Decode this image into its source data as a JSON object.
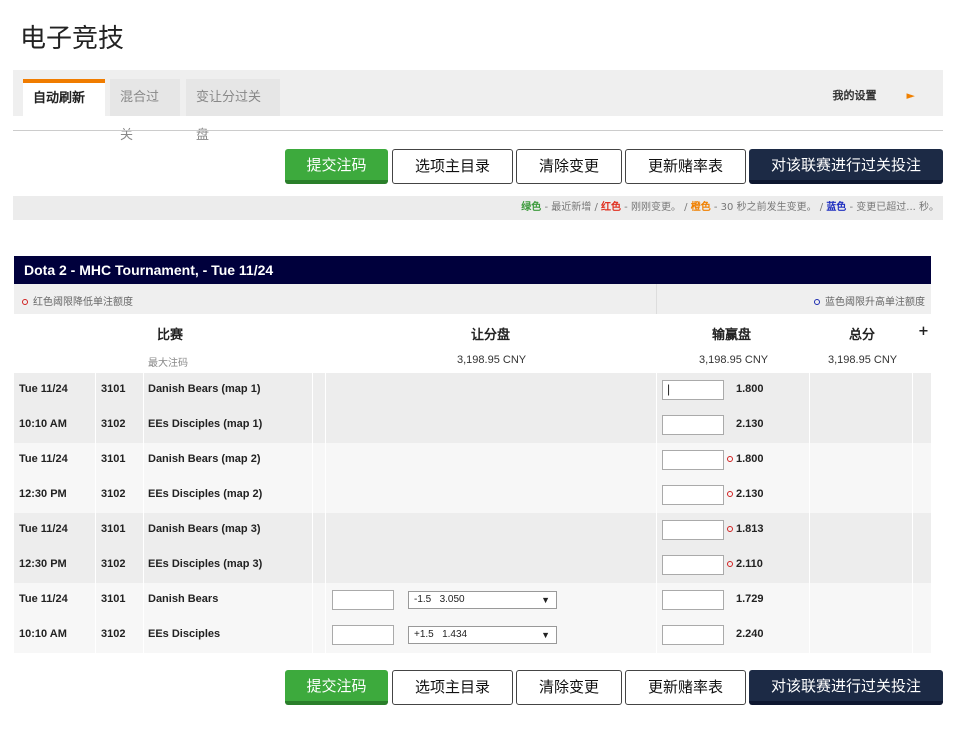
{
  "page": {
    "title": "电子竞技"
  },
  "tabs": [
    {
      "label": "自动刷新",
      "active": true
    },
    {
      "label": "混合过关",
      "active": false
    },
    {
      "label": "变让分过关盘",
      "active": false
    }
  ],
  "settings": {
    "label": "我的设置",
    "arrow": "►"
  },
  "buttons": {
    "submit": "提交注码",
    "menu": "选项主目录",
    "clear": "清除变更",
    "refresh": "更新赌率表",
    "parlay": "对该联赛进行过关投注"
  },
  "legend": {
    "green": "绿色",
    "green_text": " - 最近新增 / ",
    "red": "红色",
    "red_text": " - 刚刚变更。 / ",
    "orange": "橙色",
    "orange_text": " - 30 秒之前发生变更。 / ",
    "blue": "蓝色",
    "blue_text": " - 变更已超过... 秒。"
  },
  "league": {
    "name": "Dota 2 - MHC Tournament, - Tue 11/24"
  },
  "notes": {
    "red_note": "红色阈限降低单注额度",
    "blue_note": "蓝色阈限升高单注额度"
  },
  "table": {
    "headers": {
      "match": "比赛",
      "handicap": "让分盘",
      "moneyline": "输赢盘",
      "total": "总分",
      "plus": "+"
    },
    "max_bet_label": "最大注码",
    "max_handicap": "3,198.95 CNY",
    "max_moneyline": "3,198.95 CNY",
    "max_total": "3,198.95 CNY",
    "rows": [
      {
        "time": "Tue 11/24",
        "code": "3101",
        "team": "Danish Bears (map 1)",
        "odds": "1.800",
        "flag": false,
        "hcp": false,
        "hcp_value": "",
        "caret": "|"
      },
      {
        "time": "10:10 AM",
        "code": "3102",
        "team": "EEs Disciples (map 1)",
        "odds": "2.130",
        "flag": false,
        "hcp": false,
        "hcp_value": "",
        "caret": ""
      },
      {
        "time": "Tue 11/24",
        "code": "3101",
        "team": "Danish Bears (map 2)",
        "odds": "1.800",
        "flag": true,
        "hcp": false,
        "hcp_value": "",
        "caret": ""
      },
      {
        "time": "12:30 PM",
        "code": "3102",
        "team": "EEs Disciples (map 2)",
        "odds": "2.130",
        "flag": true,
        "hcp": false,
        "hcp_value": "",
        "caret": ""
      },
      {
        "time": "Tue 11/24",
        "code": "3101",
        "team": "Danish Bears (map 3)",
        "odds": "1.813",
        "flag": true,
        "hcp": false,
        "hcp_value": "",
        "caret": ""
      },
      {
        "time": "12:30 PM",
        "code": "3102",
        "team": "EEs Disciples (map 3)",
        "odds": "2.110",
        "flag": true,
        "hcp": false,
        "hcp_value": "",
        "caret": ""
      },
      {
        "time": "Tue 11/24",
        "code": "3101",
        "team": "Danish Bears",
        "odds": "1.729",
        "flag": false,
        "hcp": true,
        "hcp_value": "-1.5   3.050",
        "caret": ""
      },
      {
        "time": "10:10 AM",
        "code": "3102",
        "team": "EEs Disciples",
        "odds": "2.240",
        "flag": false,
        "hcp": true,
        "hcp_value": "+1.5   1.434",
        "caret": ""
      }
    ]
  },
  "colors": {
    "header_bg": "#00003c",
    "green_btn": "#3daa3d",
    "dark_btn": "#1c2a45",
    "tab_accent": "#f07c00"
  }
}
